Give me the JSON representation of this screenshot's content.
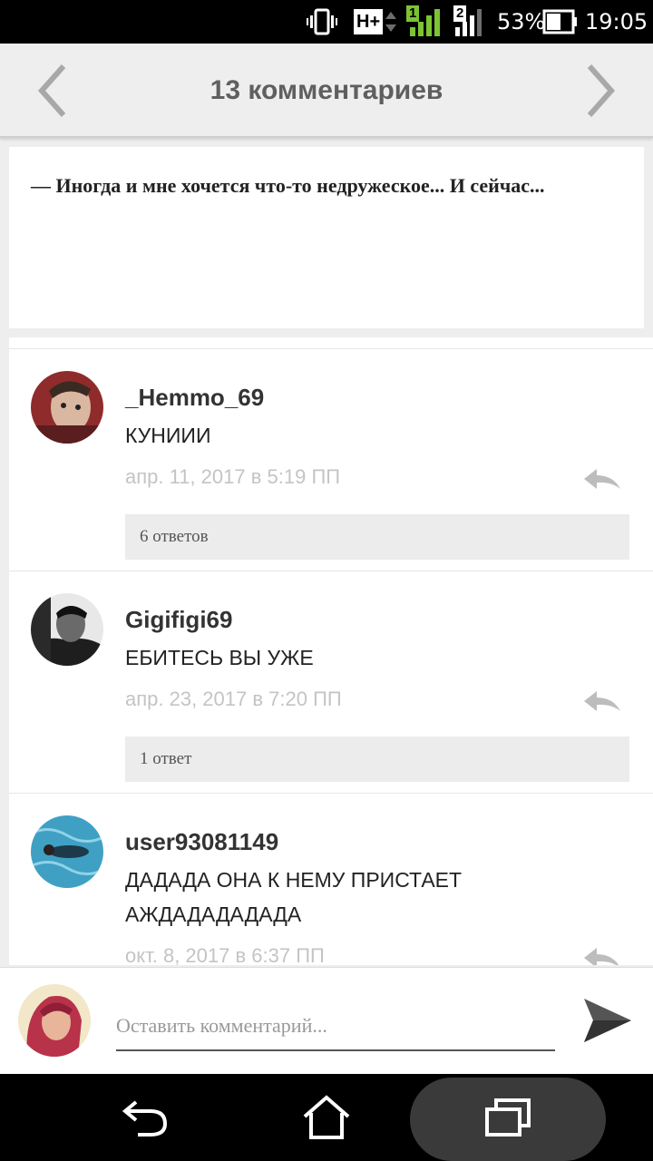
{
  "status_bar": {
    "network_badge": "H+",
    "sim1_label": "1",
    "sim2_label": "2",
    "battery_percent": "53%",
    "time": "19:05",
    "icons": [
      "vibrate-icon",
      "network-type-icon",
      "signal-sim1-icon",
      "signal-sim2-icon",
      "battery-icon"
    ]
  },
  "header": {
    "title": "13 комментариев",
    "back_icon": "chevron-left-icon",
    "forward_icon": "chevron-right-icon"
  },
  "excerpt": {
    "text": "— Иногда и мне хочется что-то недружеское... И сейчас..."
  },
  "comments": [
    {
      "username": "_Hemmo_69",
      "lines": [
        "КУНИИИ"
      ],
      "date": "апр. 11, 2017 в 5:19 ПП",
      "replies_label": "6 ответов"
    },
    {
      "username": "Gigifigi69",
      "lines": [
        "ЕБИТЕСЬ ВЫ УЖЕ"
      ],
      "date": "апр. 23, 2017 в 7:20 ПП",
      "replies_label": "1 ответ"
    },
    {
      "username": "user93081149",
      "lines": [
        "ДАДАДА ОНА К НЕМУ ПРИСТАЕТ",
        "АЖДАДАДАДАДА"
      ],
      "date": "окт. 8, 2017 в 6:37 ПП"
    }
  ],
  "composer": {
    "placeholder": "Оставить комментарий...",
    "send_icon": "send-icon"
  },
  "nav_bar": {
    "icons": [
      "back-icon",
      "home-icon",
      "recents-icon"
    ]
  },
  "colors": {
    "header_bg": "#eeeeee",
    "title_text": "#5f5f5f",
    "date_text": "#c4c4c4",
    "replies_bg": "#ececec",
    "send_icon": "#555555"
  }
}
